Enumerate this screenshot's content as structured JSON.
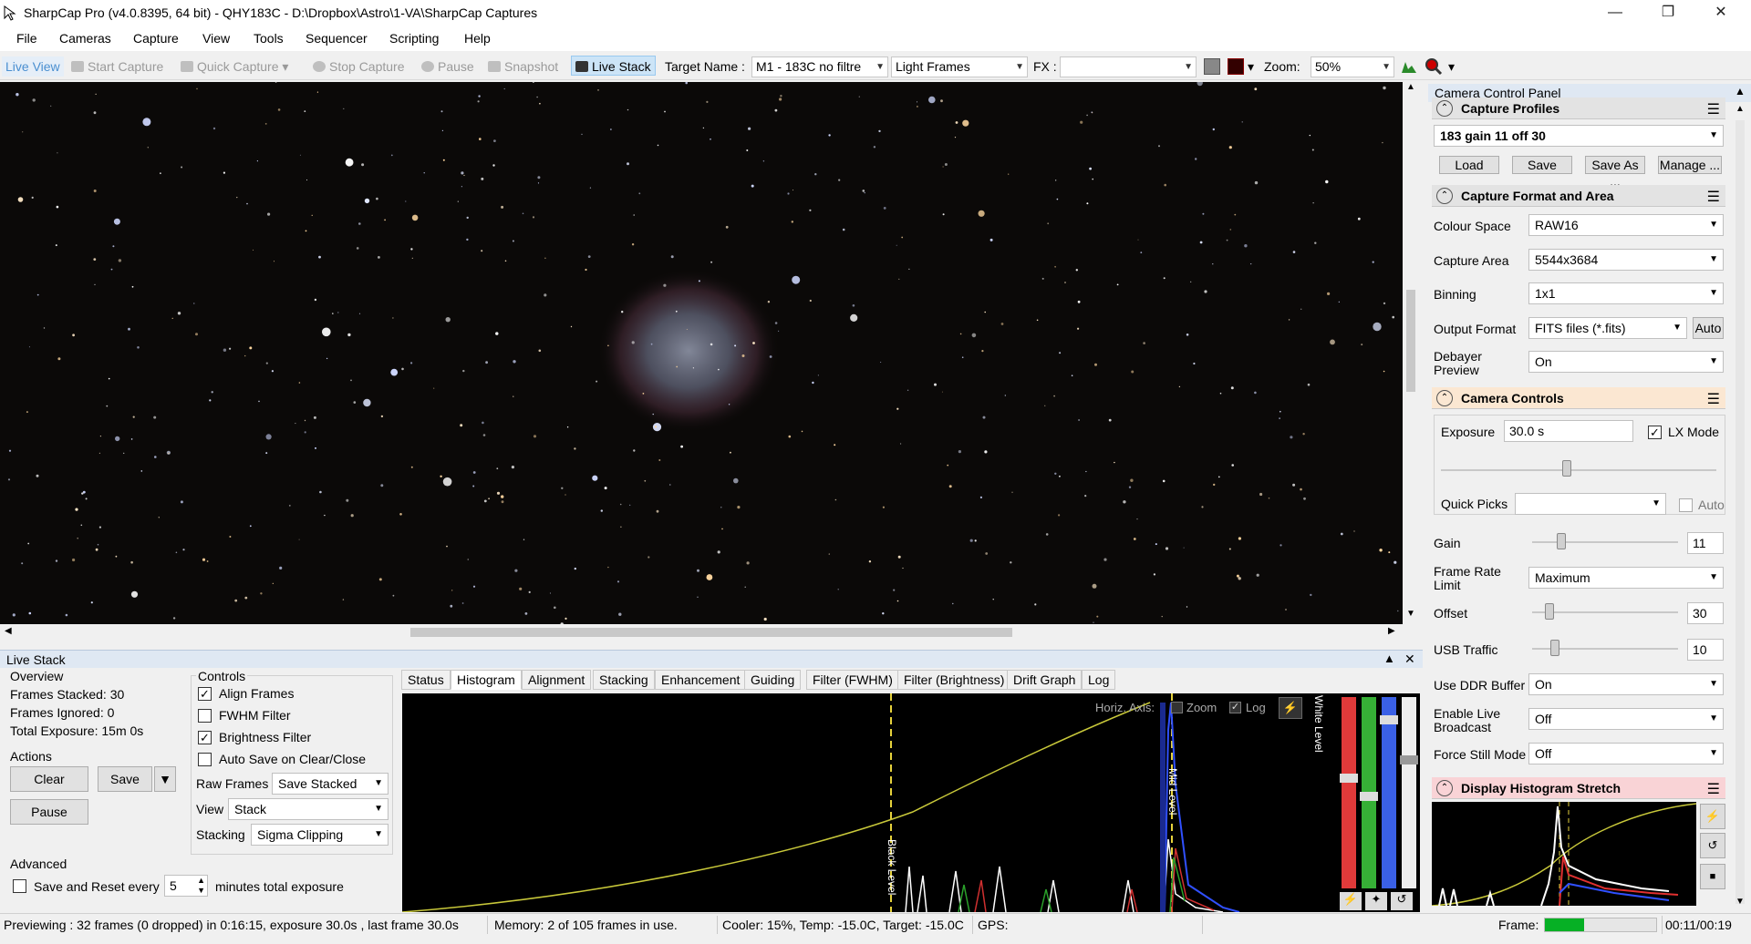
{
  "window": {
    "title": "SharpCap Pro (v4.0.8395, 64 bit) - QHY183C - D:\\Dropbox\\Astro\\1-VA\\SharpCap Captures"
  },
  "menu": [
    "File",
    "Cameras",
    "Capture",
    "View",
    "Tools",
    "Sequencer",
    "Scripting",
    "Help"
  ],
  "toolbar": {
    "live_view": "Live View",
    "start_capture": "Start Capture",
    "quick_capture": "Quick Capture",
    "stop_capture": "Stop Capture",
    "pause": "Pause",
    "snapshot": "Snapshot",
    "live_stack": "Live Stack",
    "target_name_label": "Target Name :",
    "target_name_value": "M1 - 183C no filtre",
    "frame_type": "Light Frames",
    "fx_label": "FX :",
    "fx_value": "",
    "zoom_label": "Zoom:",
    "zoom_value": "50%"
  },
  "live_stack": {
    "title": "Live Stack",
    "overview_label": "Overview",
    "frames_stacked": "Frames Stacked: 30",
    "frames_ignored": "Frames Ignored:  0",
    "total_exposure": "Total Exposure:   15m 0s",
    "actions_label": "Actions",
    "clear": "Clear",
    "save": "Save",
    "pause": "Pause",
    "advanced_label": "Advanced",
    "save_reset_label": "Save and Reset every",
    "save_reset_value": "5",
    "save_reset_suffix": "minutes total exposure",
    "controls_label": "Controls",
    "align_frames": "Align Frames",
    "fwhm_filter": "FWHM Filter",
    "brightness_filter": "Brightness Filter",
    "auto_save": "Auto Save on Clear/Close",
    "raw_frames_label": "Raw Frames",
    "raw_frames_value": "Save Stacked",
    "view_label": "View",
    "view_value": "Stack",
    "stacking_label": "Stacking",
    "stacking_value": "Sigma Clipping",
    "tabs": [
      "Status",
      "Histogram",
      "Alignment",
      "Stacking",
      "Enhancement",
      "Guiding",
      "Filter (FWHM)",
      "Filter (Brightness)",
      "Drift Graph",
      "Log"
    ],
    "histogram": {
      "horiz_axis": "Horiz. Axis:",
      "zoom": "Zoom",
      "log": "Log",
      "black_level": "Black Level",
      "mid_level": "Mid Level",
      "white_level": "White Level"
    }
  },
  "camera_panel": {
    "title": "Camera Control Panel",
    "capture_profiles": "Capture Profiles",
    "profile_value": "183 gain 11 off 30",
    "load": "Load",
    "save": "Save",
    "save_as": "Save As ...",
    "manage": "Manage ...",
    "format_area": "Capture Format and Area",
    "colour_space_label": "Colour Space",
    "colour_space_value": "RAW16",
    "capture_area_label": "Capture Area",
    "capture_area_value": "5544x3684",
    "binning_label": "Binning",
    "binning_value": "1x1",
    "output_format_label": "Output Format",
    "output_format_value": "FITS files (*.fits)",
    "auto": "Auto",
    "debayer_label": "Debayer Preview",
    "debayer_value": "On",
    "camera_controls": "Camera Controls",
    "exposure_label": "Exposure",
    "exposure_value": "30.0 s",
    "lx_mode": "LX Mode",
    "quick_picks_label": "Quick Picks",
    "quick_picks_auto": "Auto",
    "gain_label": "Gain",
    "gain_value": "11",
    "frame_rate_label": "Frame Rate Limit",
    "frame_rate_value": "Maximum",
    "offset_label": "Offset",
    "offset_value": "30",
    "usb_label": "USB Traffic",
    "usb_value": "10",
    "ddr_label": "Use DDR Buffer",
    "ddr_value": "On",
    "broadcast_label": "Enable Live Broadcast",
    "broadcast_value": "Off",
    "still_label": "Force Still Mode",
    "still_value": "Off",
    "display_stretch": "Display Histogram Stretch"
  },
  "status": {
    "previewing": "Previewing : 32 frames (0 dropped) in 0:16:15, exposure 30.0s , last frame 30.0s",
    "memory": "Memory: 2 of 105 frames in use.",
    "cooler": "Cooler: 15%, Temp: -15.0C, Target: -15.0C",
    "gps": "GPS:",
    "frame_label": "Frame:",
    "frame_progress": 0.35,
    "time": "00:11/00:19"
  },
  "colors": {
    "accent_blue": "#cce4f7",
    "profiles_header": "#e3e3e3",
    "camera_controls_header": "#fbe7d2",
    "stretch_header": "#f9d3d6",
    "progress_green": "#06b025"
  }
}
